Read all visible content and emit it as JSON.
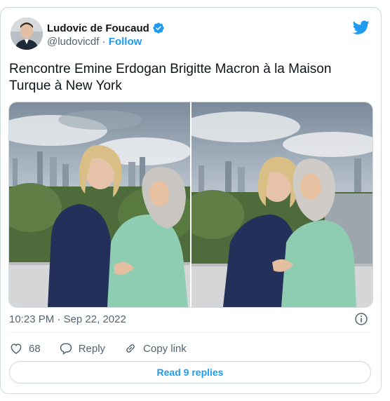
{
  "author": {
    "name": "Ludovic de Foucaud",
    "handle": "@ludovicdf",
    "separator": "·",
    "follow_label": "Follow"
  },
  "tweet": {
    "text": "Rencontre Emine Erdogan Brigitte Macron à la Maison Turque à New York",
    "time": "10:23 PM",
    "date_separator": "·",
    "date": "Sep 22, 2022"
  },
  "actions": {
    "like_count": "68",
    "reply_label": "Reply",
    "copy_link_label": "Copy link"
  },
  "replies_button": "Read 9 replies",
  "colors": {
    "accent": "#1d9bf0",
    "text": "#0f1419",
    "muted": "#536471",
    "border": "#cfd9de"
  },
  "icons": [
    "verified-badge-icon",
    "twitter-bird-icon",
    "info-icon",
    "heart-icon",
    "reply-icon",
    "link-icon"
  ]
}
